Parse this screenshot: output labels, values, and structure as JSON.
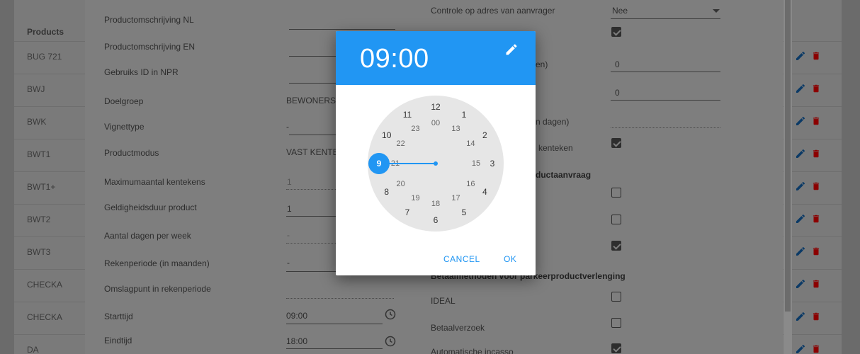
{
  "list": {
    "column_header": "Products",
    "rows": [
      "BUG 721",
      "BWJ",
      "BWK",
      "BWT1",
      "BWT1+",
      "BWT2",
      "BWT3",
      "CHECKA",
      "CHECKA",
      "DA"
    ]
  },
  "form_left": {
    "fields": [
      {
        "label": "Productomschrijving NL",
        "value": ""
      },
      {
        "label": "Productomschrijving EN",
        "value": ""
      },
      {
        "label": "Gebruiks ID in NPR",
        "value": ""
      },
      {
        "label": "Doelgroep",
        "value": "BEWONERS"
      },
      {
        "label": "Vignettype",
        "value": "-"
      },
      {
        "label": "Productmodus",
        "value": "VAST KENTE"
      },
      {
        "label": "Maximumaantal kentekens",
        "value": "1"
      },
      {
        "label": "Geldigheidsduur product",
        "value": "1"
      },
      {
        "label": "Aantal dagen per week",
        "value": "-"
      },
      {
        "label": "Rekenperiode (in maanden)",
        "value": "-"
      },
      {
        "label": "Omslagpunt in rekenperiode",
        "value": ""
      },
      {
        "label": "Starttijd",
        "value": "09:00"
      },
      {
        "label": "Eindtijd",
        "value": "18:00"
      }
    ]
  },
  "form_right": {
    "top_label": "Controle op adres van aanvrager",
    "top_value": "Nee",
    "partial_labels": [
      "en)",
      "n dagen)",
      "kenteken"
    ],
    "values": [
      "0",
      "0"
    ],
    "section_1": "ductaanvraag",
    "section_2": "Betaalmethoden voor parkeerproductverlenging",
    "payment_options": [
      "IDEAL",
      "Betaalverzoek",
      "Automatische incasso"
    ]
  },
  "time_picker": {
    "time": "09:00",
    "outer_hours": [
      "12",
      "1",
      "2",
      "3",
      "4",
      "5",
      "6",
      "7",
      "8",
      "9",
      "10",
      "11"
    ],
    "inner_hours": [
      "00",
      "13",
      "14",
      "15",
      "16",
      "17",
      "18",
      "19",
      "20",
      "21",
      "22",
      "23"
    ],
    "selected_hour": "9",
    "cancel_label": "CANCEL",
    "ok_label": "OK"
  },
  "colors": {
    "accent": "#2196f3",
    "delete": "#8b0000",
    "edit": "#0b3a66"
  }
}
